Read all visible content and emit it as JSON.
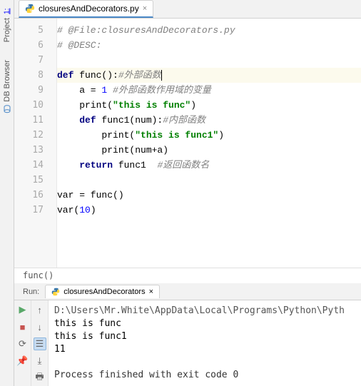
{
  "sidebar": {
    "project": {
      "label": "Project",
      "num": "1:"
    },
    "db": {
      "label": "DB Browser"
    }
  },
  "tab": {
    "name": "closuresAndDecorators.py"
  },
  "gutter": [
    "5",
    "6",
    "7",
    "8",
    "9",
    "10",
    "11",
    "12",
    "13",
    "14",
    "15",
    "16",
    "17"
  ],
  "code": {
    "l5": "# @File:closuresAndDecorators.py",
    "l6": "# @DESC:",
    "l8_def": "def ",
    "l8_fn": "func():",
    "l8_cm": "#外部函数",
    "l9_a": "    a = ",
    "l9_n": "1",
    "l9_cm": " #外部函数作用域的变量",
    "l10_a": "    print(",
    "l10_s": "\"this is func\"",
    "l10_b": ")",
    "l11_def": "    def ",
    "l11_fn": "func1(num):",
    "l11_cm": "#内部函数",
    "l12_a": "        print(",
    "l12_s": "\"this is func1\"",
    "l12_b": ")",
    "l13": "        print(num+a)",
    "l14_ret": "    return ",
    "l14_fn": "func1  ",
    "l14_cm": "#返回函数名",
    "l16": "var = func()",
    "l17_a": "var(",
    "l17_n": "10",
    "l17_b": ")"
  },
  "crumb": "func()",
  "run": {
    "label": "Run:",
    "tab": "closuresAndDecorators",
    "out": {
      "path": "D:\\Users\\Mr.White\\AppData\\Local\\Programs\\Python\\Pyth",
      "l1": "this is func",
      "l2": "this is func1",
      "l3": "11",
      "exit": "Process finished with exit code 0"
    }
  }
}
